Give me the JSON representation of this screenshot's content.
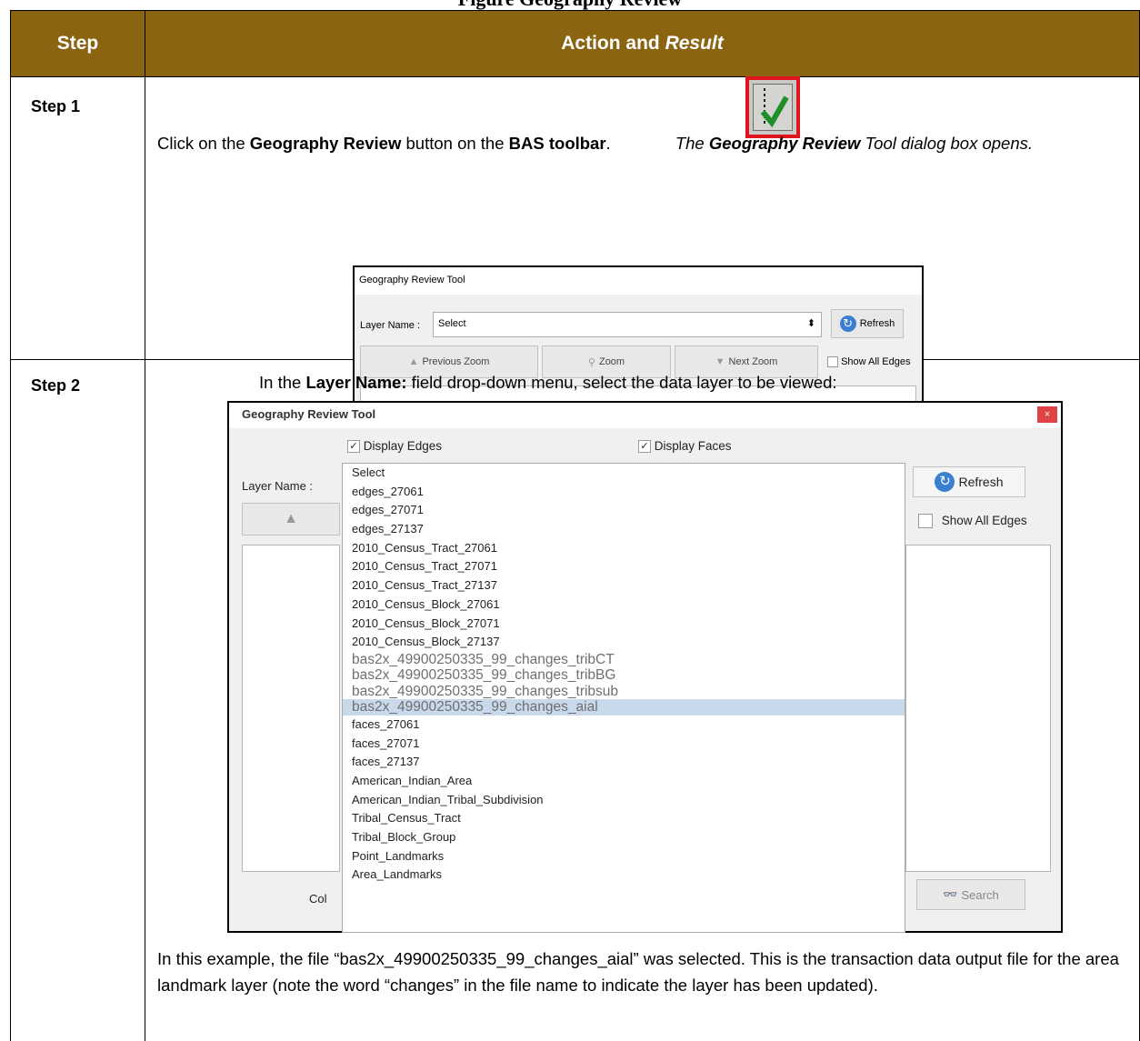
{
  "page_title": "Figure Geography Review",
  "table": {
    "header_step": "Step",
    "header_action": "Action and",
    "header_result": "Result"
  },
  "step1": {
    "label": "Step 1",
    "t1": "Click on the ",
    "b1": "Geography Review",
    "t2": " button on the ",
    "b2": "BAS toolbar",
    "t3": ". ",
    "i1": "The ",
    "bi1": "Geography Review",
    "i2": " Tool dialog box opens.",
    "dialog": {
      "title": "Geography Review Tool",
      "layer_label": "Layer Name :",
      "select_value": "Select",
      "refresh": "Refresh",
      "prev_zoom": "Previous Zoom",
      "zoom": "Zoom",
      "next_zoom": "Next Zoom",
      "show_all_edges": "Show All Edges"
    }
  },
  "step2": {
    "label": "Step 2",
    "t1": "In the ",
    "b1": "Layer Name:",
    "t2": " field drop-down menu, select the data layer to be viewed:",
    "dialog": {
      "title": "Geography Review Tool",
      "close": "×",
      "display_edges": "Display Edges",
      "display_faces": "Display Faces",
      "layer_label": "Layer Name :",
      "refresh": "Refresh",
      "show_all_edges": "Show All Edges",
      "search": "Search",
      "col_label": "Col",
      "items": [
        "Select",
        "edges_27061",
        "edges_27071",
        "edges_27137",
        "2010_Census_Tract_27061",
        "2010_Census_Tract_27071",
        "2010_Census_Tract_27137",
        "2010_Census_Block_27061",
        "2010_Census_Block_27071",
        "2010_Census_Block_27137",
        "bas2x_49900250335_99_changes_tribCT",
        "bas2x_49900250335_99_changes_tribBG",
        "bas2x_49900250335_99_changes_tribsub",
        "bas2x_49900250335_99_changes_aial",
        "faces_27061",
        "faces_27071",
        "faces_27137",
        "American_Indian_Area",
        "American_Indian_Tribal_Subdivision",
        "Tribal_Census_Tract",
        "Tribal_Block_Group",
        "Point_Landmarks",
        "Area_Landmarks"
      ],
      "selected_index": 13
    },
    "para": "In this example, the file “bas2x_49900250335_99_changes_aial” was selected. This is the transaction data output file for the area landmark layer (note the word “changes” in the file name to indicate the layer has been updated)."
  }
}
